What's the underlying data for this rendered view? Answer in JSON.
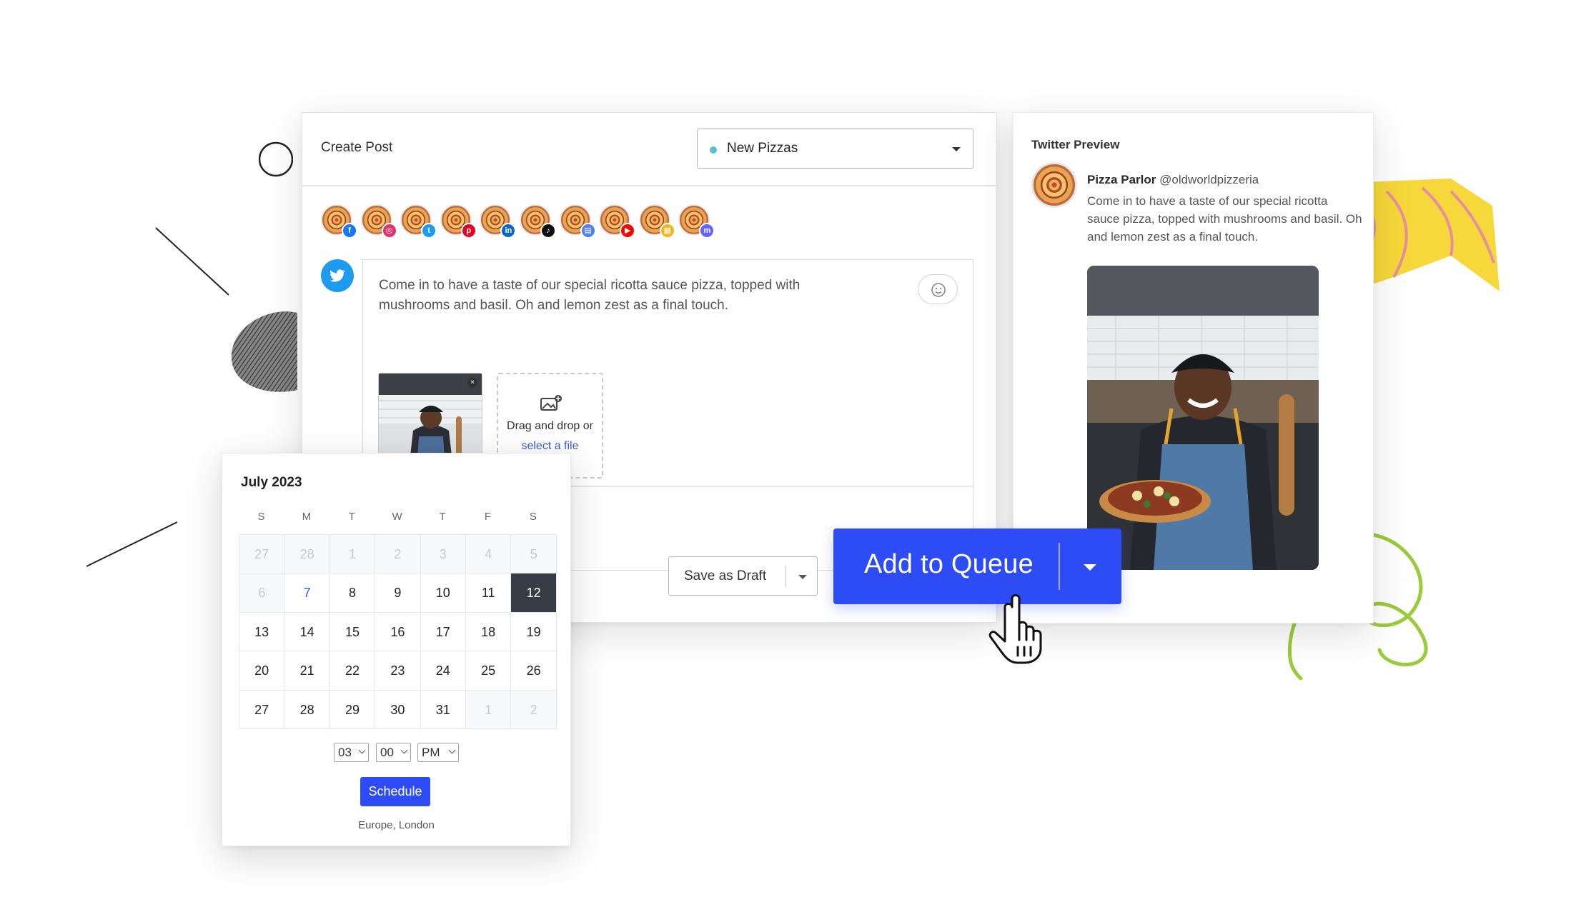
{
  "composer": {
    "title": "Create Post",
    "campaign": {
      "label": "New Pizzas",
      "dot_color": "#53c2c9"
    },
    "accounts": [
      {
        "network": "facebook-icon",
        "badge": "f",
        "color": "#1877f2"
      },
      {
        "network": "instagram-icon",
        "badge": "◎",
        "color": "#e1306c"
      },
      {
        "network": "twitter-icon",
        "badge": "t",
        "color": "#1d9bf0"
      },
      {
        "network": "pinterest-icon",
        "badge": "p",
        "color": "#e60023"
      },
      {
        "network": "linkedin-icon",
        "badge": "in",
        "color": "#0a66c2"
      },
      {
        "network": "tiktok-icon",
        "badge": "♪",
        "color": "#111111"
      },
      {
        "network": "google-business-icon",
        "badge": "▤",
        "color": "#4f7df2"
      },
      {
        "network": "youtube-icon",
        "badge": "▶",
        "color": "#ff0000"
      },
      {
        "network": "blog-icon",
        "badge": "▦",
        "color": "#f2b51f"
      },
      {
        "network": "mastodon-icon",
        "badge": "m",
        "color": "#6364ff"
      }
    ],
    "post_text": "Come in to have a taste of our special ricotta sauce pizza, topped with mushrooms and basil. Oh and lemon zest as a final touch.",
    "dropzone": {
      "text": "Drag and drop or",
      "link": "select a file"
    },
    "save_draft": "Save as Draft"
  },
  "add_to_queue": "Add to Queue",
  "preview": {
    "title": "Twitter Preview",
    "name": "Pizza Parlor",
    "handle": "@oldworldpizzeria",
    "text": "Come in to have a taste of our special ricotta sauce pizza, topped with mushrooms and basil. Oh and lemon zest as a final touch."
  },
  "calendar": {
    "month": "July 2023",
    "weekdays": [
      "S",
      "M",
      "T",
      "W",
      "T",
      "F",
      "S"
    ],
    "weeks": [
      [
        "27",
        "28",
        "1",
        "2",
        "3",
        "4",
        "5"
      ],
      [
        "6",
        "7",
        "8",
        "9",
        "10",
        "11",
        "12"
      ],
      [
        "13",
        "14",
        "15",
        "16",
        "17",
        "18",
        "19"
      ],
      [
        "20",
        "21",
        "22",
        "23",
        "24",
        "25",
        "26"
      ],
      [
        "27",
        "28",
        "29",
        "30",
        "31",
        "1",
        "2"
      ]
    ],
    "muted_cells": [
      "0-0",
      "0-1",
      "0-2",
      "0-3",
      "0-4",
      "0-5",
      "0-6",
      "1-0",
      "4-5",
      "4-6"
    ],
    "today_cell": "1-1",
    "selected_cell": "1-6",
    "hour": "03",
    "minute": "00",
    "meridiem": "PM",
    "schedule_label": "Schedule",
    "timezone": "Europe, London"
  },
  "colors": {
    "accent": "#2d4cf5",
    "twitter": "#1d9bf0",
    "selected_day": "#373c44"
  }
}
